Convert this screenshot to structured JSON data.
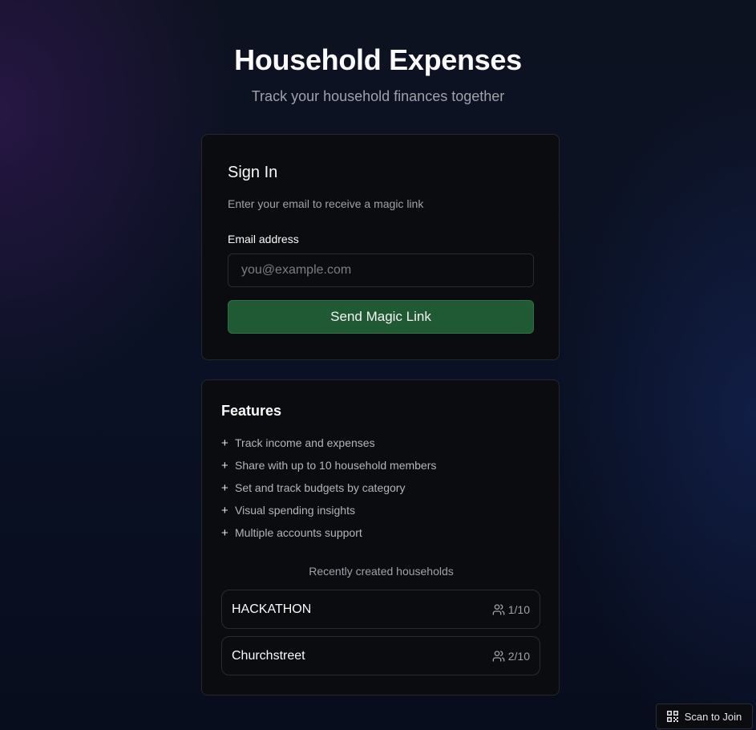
{
  "header": {
    "title": "Household Expenses",
    "subtitle": "Track your household finances together"
  },
  "signin": {
    "title": "Sign In",
    "description": "Enter your email to receive a magic link",
    "email_label": "Email address",
    "email_placeholder": "you@example.com",
    "email_value": "",
    "button_label": "Send Magic Link",
    "button_color": "#1f5a35"
  },
  "features": {
    "title": "Features",
    "items": [
      "Track income and expenses",
      "Share with up to 10 household members",
      "Set and track budgets by category",
      "Visual spending insights",
      "Multiple accounts support"
    ],
    "recent_label": "Recently created households",
    "households": [
      {
        "name": "HACKATHON",
        "members": "1/10",
        "icon": "users-icon"
      },
      {
        "name": "Churchstreet",
        "members": "2/10",
        "icon": "users-icon"
      }
    ]
  },
  "scan": {
    "label": "Scan to Join",
    "icon": "qr-code-icon"
  }
}
